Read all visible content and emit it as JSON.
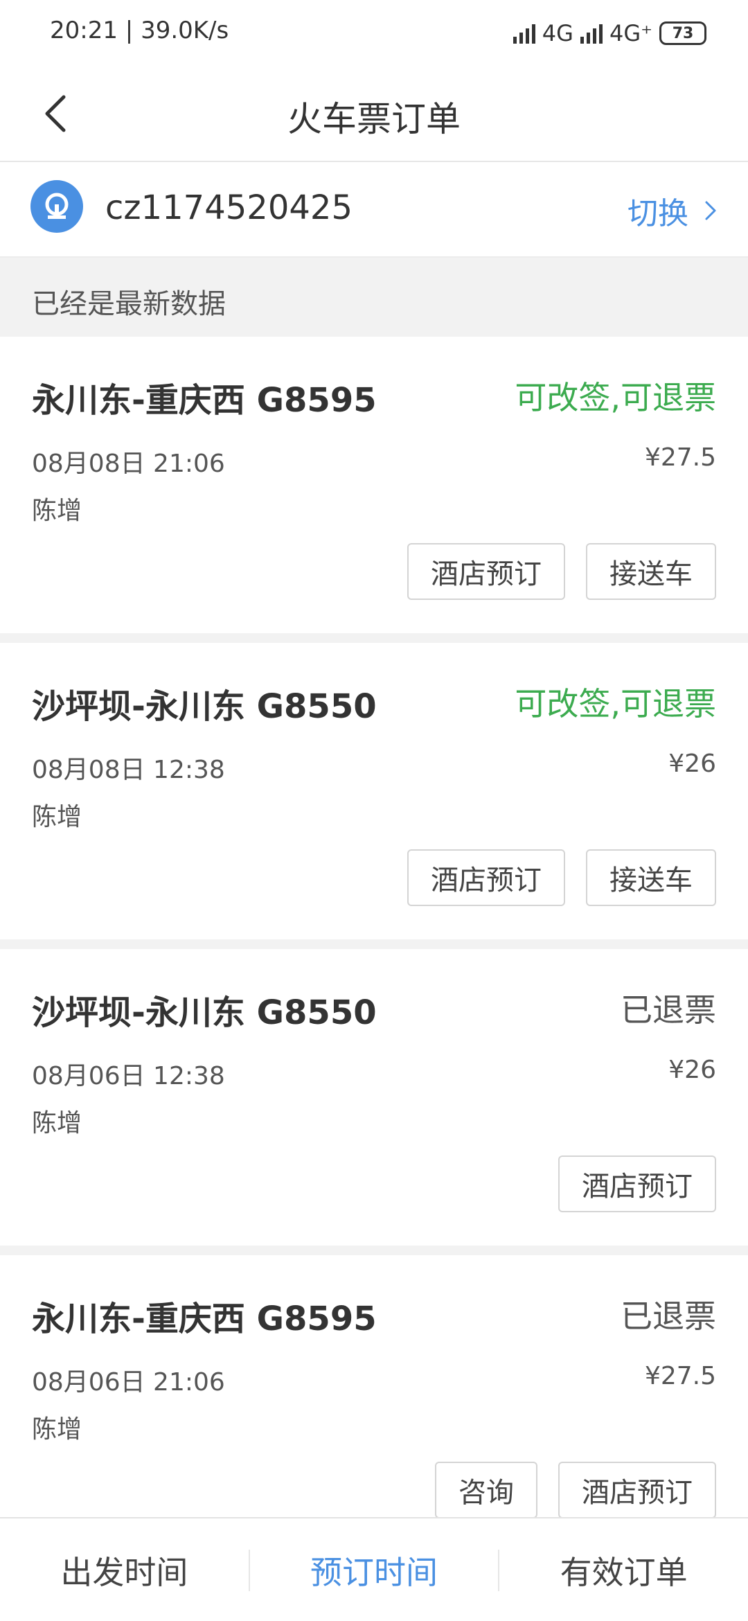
{
  "status_bar": {
    "time": "20:21",
    "speed": "39.0K/s",
    "net1": "4G",
    "net2": "4G⁺",
    "battery": "73"
  },
  "header": {
    "title": "火车票订单"
  },
  "account": {
    "username": "cz1174520425",
    "switch_label": "切换"
  },
  "notice": "已经是最新数据",
  "orders": [
    {
      "route": "永川东-重庆西 G8595",
      "status": "可改签,可退票",
      "datetime": "08月08日 21:06",
      "price": "¥27.5",
      "passenger": "陈增",
      "buttons": [
        "酒店预订",
        "接送车"
      ]
    },
    {
      "route": "沙坪坝-永川东 G8550",
      "status": "可改签,可退票",
      "datetime": "08月08日 12:38",
      "price": "¥26",
      "passenger": "陈增",
      "buttons": [
        "酒店预订",
        "接送车"
      ]
    },
    {
      "route": "沙坪坝-永川东 G8550",
      "status": "已退票",
      "datetime": "08月06日 12:38",
      "price": "¥26",
      "passenger": "陈增",
      "buttons": [
        "酒店预订"
      ]
    },
    {
      "route": "永川东-重庆西 G8595",
      "status": "已退票",
      "datetime": "08月06日 21:06",
      "price": "¥27.5",
      "passenger": "陈增",
      "buttons": [
        "咨询",
        "酒店预订"
      ]
    }
  ],
  "tabs": [
    {
      "label": "出发时间",
      "active": false
    },
    {
      "label": "预订时间",
      "active": true
    },
    {
      "label": "有效订单",
      "active": false
    }
  ],
  "colors": {
    "accent": "#4a90e2",
    "status_ok": "#3cab4f"
  }
}
